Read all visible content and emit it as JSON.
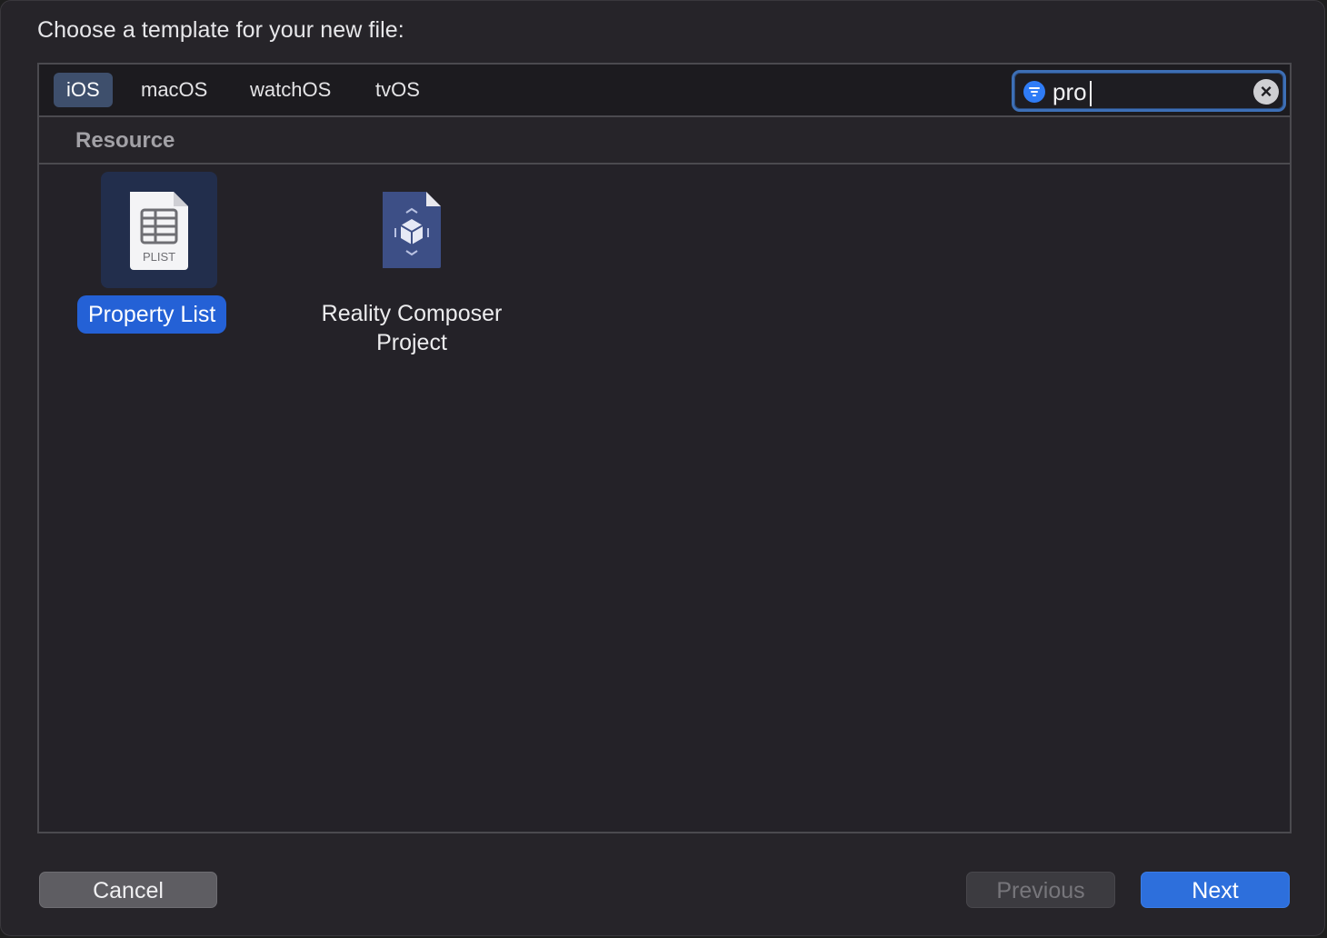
{
  "dialog": {
    "prompt": "Choose a template for your new file:"
  },
  "platform_tabs": [
    {
      "label": "iOS",
      "selected": true
    },
    {
      "label": "macOS",
      "selected": false
    },
    {
      "label": "watchOS",
      "selected": false
    },
    {
      "label": "tvOS",
      "selected": false
    }
  ],
  "search": {
    "value": "pro",
    "filter_icon": "filter-icon",
    "clear_icon": "clear-icon"
  },
  "section": {
    "title": "Resource"
  },
  "templates": [
    {
      "label": "Property List",
      "icon": "plist-file-icon",
      "icon_caption": "PLIST",
      "selected": true
    },
    {
      "label_line1": "Reality Composer",
      "label_line2": "Project",
      "icon": "reality-composer-file-icon",
      "selected": false
    }
  ],
  "buttons": {
    "cancel": "Cancel",
    "previous": "Previous",
    "next": "Next"
  },
  "colors": {
    "accent": "#2461d6",
    "background": "#262429",
    "tab_selected": "#3e4f6c"
  }
}
